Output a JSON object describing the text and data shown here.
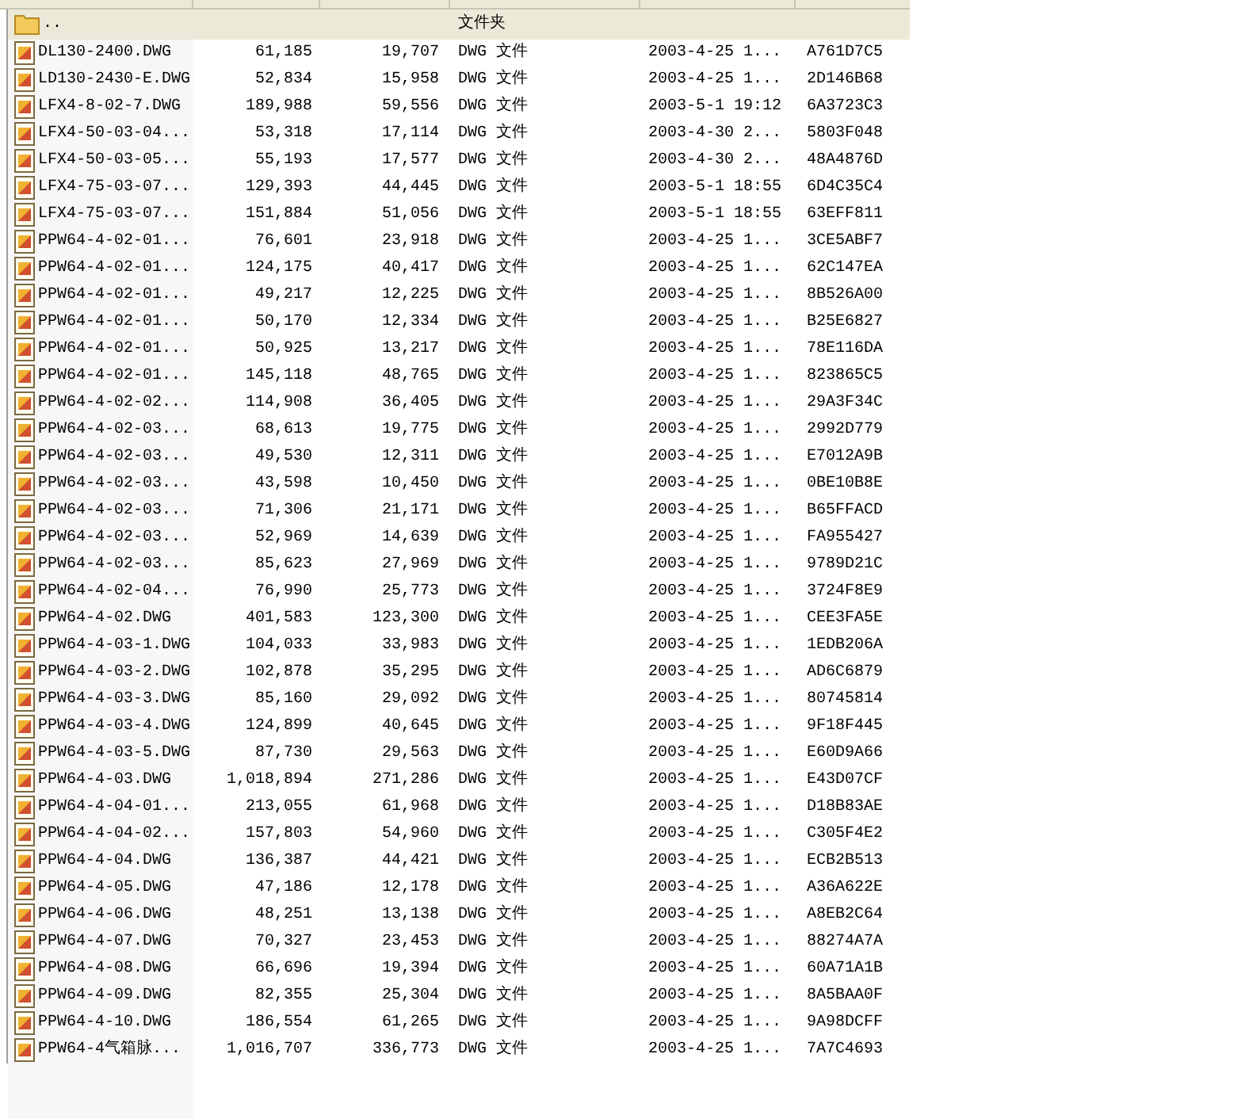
{
  "rows": [
    {
      "kind": "folder",
      "name": "..",
      "size": "",
      "packed": "",
      "type": "文件夹",
      "modified": "",
      "crc": ""
    },
    {
      "kind": "file",
      "name": "DL130-2400.DWG",
      "size": "61,185",
      "packed": "19,707",
      "type": "DWG 文件",
      "modified": "2003-4-25 1...",
      "crc": "A761D7C5"
    },
    {
      "kind": "file",
      "name": "LD130-2430-E.DWG",
      "size": "52,834",
      "packed": "15,958",
      "type": "DWG 文件",
      "modified": "2003-4-25 1...",
      "crc": "2D146B68"
    },
    {
      "kind": "file",
      "name": "LFX4-8-02-7.DWG",
      "size": "189,988",
      "packed": "59,556",
      "type": "DWG 文件",
      "modified": "2003-5-1 19:12",
      "crc": "6A3723C3"
    },
    {
      "kind": "file",
      "name": "LFX4-50-03-04...",
      "size": "53,318",
      "packed": "17,114",
      "type": "DWG 文件",
      "modified": "2003-4-30 2...",
      "crc": "5803F048"
    },
    {
      "kind": "file",
      "name": "LFX4-50-03-05...",
      "size": "55,193",
      "packed": "17,577",
      "type": "DWG 文件",
      "modified": "2003-4-30 2...",
      "crc": "48A4876D"
    },
    {
      "kind": "file",
      "name": "LFX4-75-03-07...",
      "size": "129,393",
      "packed": "44,445",
      "type": "DWG 文件",
      "modified": "2003-5-1 18:55",
      "crc": "6D4C35C4"
    },
    {
      "kind": "file",
      "name": "LFX4-75-03-07...",
      "size": "151,884",
      "packed": "51,056",
      "type": "DWG 文件",
      "modified": "2003-5-1 18:55",
      "crc": "63EFF811"
    },
    {
      "kind": "file",
      "name": "PPW64-4-02-01...",
      "size": "76,601",
      "packed": "23,918",
      "type": "DWG 文件",
      "modified": "2003-4-25 1...",
      "crc": "3CE5ABF7"
    },
    {
      "kind": "file",
      "name": "PPW64-4-02-01...",
      "size": "124,175",
      "packed": "40,417",
      "type": "DWG 文件",
      "modified": "2003-4-25 1...",
      "crc": "62C147EA"
    },
    {
      "kind": "file",
      "name": "PPW64-4-02-01...",
      "size": "49,217",
      "packed": "12,225",
      "type": "DWG 文件",
      "modified": "2003-4-25 1...",
      "crc": "8B526A00"
    },
    {
      "kind": "file",
      "name": "PPW64-4-02-01...",
      "size": "50,170",
      "packed": "12,334",
      "type": "DWG 文件",
      "modified": "2003-4-25 1...",
      "crc": "B25E6827"
    },
    {
      "kind": "file",
      "name": "PPW64-4-02-01...",
      "size": "50,925",
      "packed": "13,217",
      "type": "DWG 文件",
      "modified": "2003-4-25 1...",
      "crc": "78E116DA"
    },
    {
      "kind": "file",
      "name": "PPW64-4-02-01...",
      "size": "145,118",
      "packed": "48,765",
      "type": "DWG 文件",
      "modified": "2003-4-25 1...",
      "crc": "823865C5"
    },
    {
      "kind": "file",
      "name": "PPW64-4-02-02...",
      "size": "114,908",
      "packed": "36,405",
      "type": "DWG 文件",
      "modified": "2003-4-25 1...",
      "crc": "29A3F34C"
    },
    {
      "kind": "file",
      "name": "PPW64-4-02-03...",
      "size": "68,613",
      "packed": "19,775",
      "type": "DWG 文件",
      "modified": "2003-4-25 1...",
      "crc": "2992D779"
    },
    {
      "kind": "file",
      "name": "PPW64-4-02-03...",
      "size": "49,530",
      "packed": "12,311",
      "type": "DWG 文件",
      "modified": "2003-4-25 1...",
      "crc": "E7012A9B"
    },
    {
      "kind": "file",
      "name": "PPW64-4-02-03...",
      "size": "43,598",
      "packed": "10,450",
      "type": "DWG 文件",
      "modified": "2003-4-25 1...",
      "crc": "0BE10B8E"
    },
    {
      "kind": "file",
      "name": "PPW64-4-02-03...",
      "size": "71,306",
      "packed": "21,171",
      "type": "DWG 文件",
      "modified": "2003-4-25 1...",
      "crc": "B65FFACD"
    },
    {
      "kind": "file",
      "name": "PPW64-4-02-03...",
      "size": "52,969",
      "packed": "14,639",
      "type": "DWG 文件",
      "modified": "2003-4-25 1...",
      "crc": "FA955427"
    },
    {
      "kind": "file",
      "name": "PPW64-4-02-03...",
      "size": "85,623",
      "packed": "27,969",
      "type": "DWG 文件",
      "modified": "2003-4-25 1...",
      "crc": "9789D21C"
    },
    {
      "kind": "file",
      "name": "PPW64-4-02-04...",
      "size": "76,990",
      "packed": "25,773",
      "type": "DWG 文件",
      "modified": "2003-4-25 1...",
      "crc": "3724F8E9"
    },
    {
      "kind": "file",
      "name": "PPW64-4-02.DWG",
      "size": "401,583",
      "packed": "123,300",
      "type": "DWG 文件",
      "modified": "2003-4-25 1...",
      "crc": "CEE3FA5E"
    },
    {
      "kind": "file",
      "name": "PPW64-4-03-1.DWG",
      "size": "104,033",
      "packed": "33,983",
      "type": "DWG 文件",
      "modified": "2003-4-25 1...",
      "crc": "1EDB206A"
    },
    {
      "kind": "file",
      "name": "PPW64-4-03-2.DWG",
      "size": "102,878",
      "packed": "35,295",
      "type": "DWG 文件",
      "modified": "2003-4-25 1...",
      "crc": "AD6C6879"
    },
    {
      "kind": "file",
      "name": "PPW64-4-03-3.DWG",
      "size": "85,160",
      "packed": "29,092",
      "type": "DWG 文件",
      "modified": "2003-4-25 1...",
      "crc": "80745814"
    },
    {
      "kind": "file",
      "name": "PPW64-4-03-4.DWG",
      "size": "124,899",
      "packed": "40,645",
      "type": "DWG 文件",
      "modified": "2003-4-25 1...",
      "crc": "9F18F445"
    },
    {
      "kind": "file",
      "name": "PPW64-4-03-5.DWG",
      "size": "87,730",
      "packed": "29,563",
      "type": "DWG 文件",
      "modified": "2003-4-25 1...",
      "crc": "E60D9A66"
    },
    {
      "kind": "file",
      "name": "PPW64-4-03.DWG",
      "size": "1,018,894",
      "packed": "271,286",
      "type": "DWG 文件",
      "modified": "2003-4-25 1...",
      "crc": "E43D07CF"
    },
    {
      "kind": "file",
      "name": "PPW64-4-04-01...",
      "size": "213,055",
      "packed": "61,968",
      "type": "DWG 文件",
      "modified": "2003-4-25 1...",
      "crc": "D18B83AE"
    },
    {
      "kind": "file",
      "name": "PPW64-4-04-02...",
      "size": "157,803",
      "packed": "54,960",
      "type": "DWG 文件",
      "modified": "2003-4-25 1...",
      "crc": "C305F4E2"
    },
    {
      "kind": "file",
      "name": "PPW64-4-04.DWG",
      "size": "136,387",
      "packed": "44,421",
      "type": "DWG 文件",
      "modified": "2003-4-25 1...",
      "crc": "ECB2B513"
    },
    {
      "kind": "file",
      "name": "PPW64-4-05.DWG",
      "size": "47,186",
      "packed": "12,178",
      "type": "DWG 文件",
      "modified": "2003-4-25 1...",
      "crc": "A36A622E"
    },
    {
      "kind": "file",
      "name": "PPW64-4-06.DWG",
      "size": "48,251",
      "packed": "13,138",
      "type": "DWG 文件",
      "modified": "2003-4-25 1...",
      "crc": "A8EB2C64"
    },
    {
      "kind": "file",
      "name": "PPW64-4-07.DWG",
      "size": "70,327",
      "packed": "23,453",
      "type": "DWG 文件",
      "modified": "2003-4-25 1...",
      "crc": "88274A7A"
    },
    {
      "kind": "file",
      "name": "PPW64-4-08.DWG",
      "size": "66,696",
      "packed": "19,394",
      "type": "DWG 文件",
      "modified": "2003-4-25 1...",
      "crc": "60A71A1B"
    },
    {
      "kind": "file",
      "name": "PPW64-4-09.DWG",
      "size": "82,355",
      "packed": "25,304",
      "type": "DWG 文件",
      "modified": "2003-4-25 1...",
      "crc": "8A5BAA0F"
    },
    {
      "kind": "file",
      "name": "PPW64-4-10.DWG",
      "size": "186,554",
      "packed": "61,265",
      "type": "DWG 文件",
      "modified": "2003-4-25 1...",
      "crc": "9A98DCFF"
    },
    {
      "kind": "file",
      "name": "PPW64-4气箱脉...",
      "size": "1,016,707",
      "packed": "336,773",
      "type": "DWG 文件",
      "modified": "2003-4-25 1...",
      "crc": "7A7C4693"
    }
  ]
}
